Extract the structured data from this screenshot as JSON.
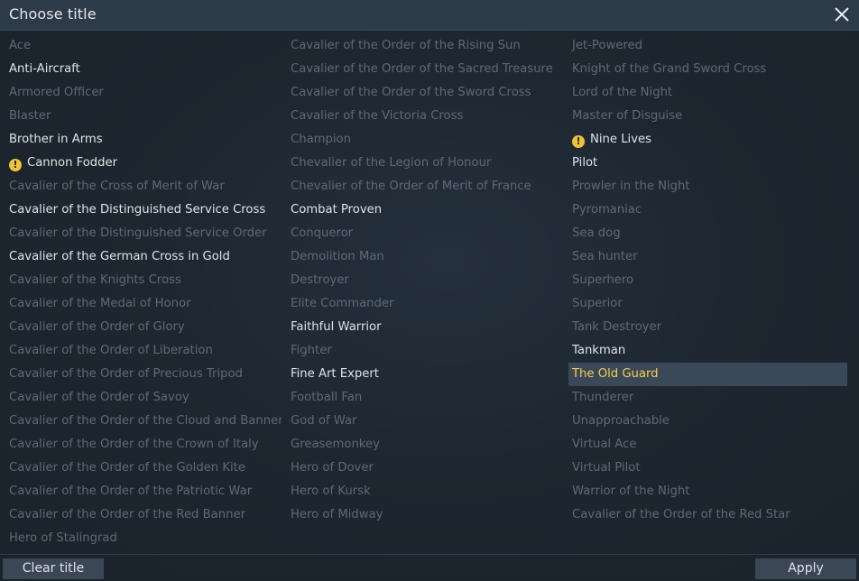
{
  "dialog": {
    "title": "Choose title",
    "clear_label": "Clear title",
    "apply_label": "Apply"
  },
  "columns": [
    [
      {
        "label": "Ace",
        "state": "locked"
      },
      {
        "label": "Anti-Aircraft",
        "state": "unlocked"
      },
      {
        "label": "Armored Officer",
        "state": "locked"
      },
      {
        "label": "Blaster",
        "state": "locked"
      },
      {
        "label": "Brother in Arms",
        "state": "unlocked"
      },
      {
        "label": "Cannon Fodder",
        "state": "warn"
      },
      {
        "label": "Cavalier of the Cross of Merit of War",
        "state": "locked"
      },
      {
        "label": "Cavalier of the Distinguished Service Cross",
        "state": "unlocked"
      },
      {
        "label": "Cavalier of the Distinguished Service Order",
        "state": "locked"
      },
      {
        "label": "Cavalier of the German Cross in Gold",
        "state": "unlocked"
      },
      {
        "label": "Cavalier of the Knights Cross",
        "state": "locked"
      },
      {
        "label": "Cavalier of the Medal of Honor",
        "state": "locked"
      },
      {
        "label": "Cavalier of the Order of Glory",
        "state": "locked"
      },
      {
        "label": "Cavalier of the Order of Liberation",
        "state": "locked"
      },
      {
        "label": "Cavalier of the Order of Precious Tripod",
        "state": "locked"
      },
      {
        "label": "Cavalier of the Order of Savoy",
        "state": "locked"
      },
      {
        "label": "Cavalier of the Order of the Cloud and Banner",
        "state": "locked"
      },
      {
        "label": "Cavalier of the Order of the Crown of Italy",
        "state": "locked"
      },
      {
        "label": "Cavalier of the Order of the Golden Kite",
        "state": "locked"
      },
      {
        "label": "Cavalier of the Order of the Patriotic War",
        "state": "locked"
      },
      {
        "label": "Cavalier of the Order of the Red Banner",
        "state": "locked"
      },
      {
        "label": "Hero of Stalingrad",
        "state": "locked"
      }
    ],
    [
      {
        "label": "Cavalier of the Order of the Rising Sun",
        "state": "locked"
      },
      {
        "label": "Cavalier of the Order of the Sacred Treasure",
        "state": "locked"
      },
      {
        "label": "Cavalier of the Order of the Sword Cross",
        "state": "locked"
      },
      {
        "label": "Cavalier of the Victoria Cross",
        "state": "locked"
      },
      {
        "label": "Champion",
        "state": "locked"
      },
      {
        "label": "Chevalier of the Legion of Honour",
        "state": "locked"
      },
      {
        "label": "Chevalier of the Order of Merit of France",
        "state": "locked"
      },
      {
        "label": "Combat Proven",
        "state": "unlocked"
      },
      {
        "label": "Conqueror",
        "state": "locked"
      },
      {
        "label": "Demolition Man",
        "state": "locked"
      },
      {
        "label": "Destroyer",
        "state": "locked"
      },
      {
        "label": "Elite Commander",
        "state": "locked"
      },
      {
        "label": "Faithful Warrior",
        "state": "unlocked"
      },
      {
        "label": "Fighter",
        "state": "locked"
      },
      {
        "label": "Fine Art Expert",
        "state": "unlocked"
      },
      {
        "label": "Football Fan",
        "state": "locked"
      },
      {
        "label": "God of War",
        "state": "locked"
      },
      {
        "label": "Greasemonkey",
        "state": "locked"
      },
      {
        "label": "Hero of Dover",
        "state": "locked"
      },
      {
        "label": "Hero of Kursk",
        "state": "locked"
      },
      {
        "label": "Hero of Midway",
        "state": "locked"
      }
    ],
    [
      {
        "label": "Jet-Powered",
        "state": "locked"
      },
      {
        "label": "Knight of the Grand Sword Cross",
        "state": "locked"
      },
      {
        "label": "Lord of the Night",
        "state": "locked"
      },
      {
        "label": "Master of Disguise",
        "state": "locked"
      },
      {
        "label": "Nine Lives",
        "state": "warn"
      },
      {
        "label": "Pilot",
        "state": "unlocked"
      },
      {
        "label": "Prowler in the Night",
        "state": "locked"
      },
      {
        "label": "Pyromaniac",
        "state": "locked"
      },
      {
        "label": "Sea dog",
        "state": "locked"
      },
      {
        "label": "Sea hunter",
        "state": "locked"
      },
      {
        "label": "Superhero",
        "state": "locked"
      },
      {
        "label": "Superior",
        "state": "locked"
      },
      {
        "label": "Tank Destroyer",
        "state": "locked"
      },
      {
        "label": "Tankman",
        "state": "unlocked"
      },
      {
        "label": "The Old Guard",
        "state": "selected"
      },
      {
        "label": "Thunderer",
        "state": "locked"
      },
      {
        "label": "Unapproachable",
        "state": "locked"
      },
      {
        "label": "Virtual Ace",
        "state": "locked"
      },
      {
        "label": "Virtual Pilot",
        "state": "locked"
      },
      {
        "label": "Warrior of the Night",
        "state": "locked"
      },
      {
        "label": "Cavalier of the Order of the Red Star",
        "state": "locked"
      }
    ]
  ],
  "icons": {
    "close": "close-icon",
    "warning": "warning-icon"
  },
  "colors": {
    "locked_text": "#5d6a76",
    "unlocked_text": "#dfe3e7",
    "selected_text": "#f3cf4d",
    "warning": "#f0c23a"
  }
}
